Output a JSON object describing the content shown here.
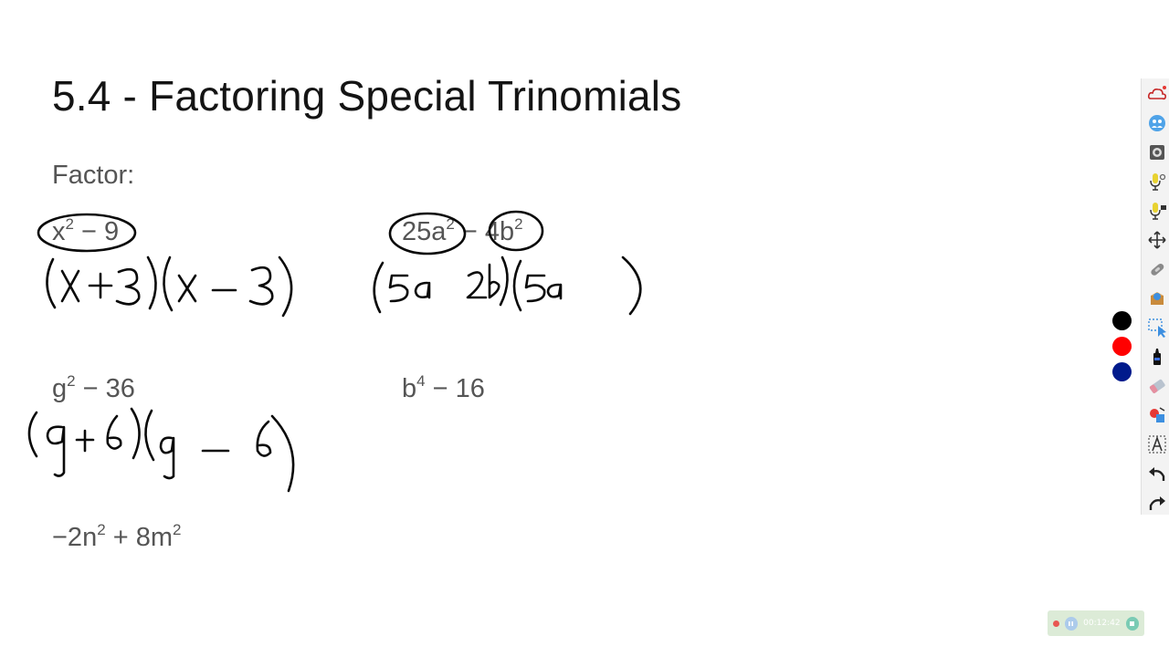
{
  "slide": {
    "title": "5.4 - Factoring Special Trinomials",
    "prompt": "Factor:"
  },
  "problems": [
    {
      "pre": "x",
      "sup1": "2",
      "mid": " − 9",
      "sup2": "",
      "post": ""
    },
    {
      "pre": "25a",
      "sup1": "2",
      "mid": " − 4b",
      "sup2": "2",
      "post": ""
    },
    {
      "pre": "g",
      "sup1": "2",
      "mid": " − 36",
      "sup2": "",
      "post": ""
    },
    {
      "pre": "b",
      "sup1": "4",
      "mid": " − 16",
      "sup2": "",
      "post": ""
    },
    {
      "pre": "−2n",
      "sup1": "2",
      "mid": " + 8m",
      "sup2": "2",
      "post": ""
    }
  ],
  "pen_colors": [
    "#000000",
    "#ff0000",
    "#001a8c"
  ],
  "toolbar": {
    "tools": [
      "myscreen-cloud-icon",
      "community-icon",
      "screenshot-icon",
      "mic-settings-icon",
      "mic-folder-icon",
      "move-icon",
      "link-icon",
      "shapes-icon",
      "select-icon",
      "marker-icon",
      "eraser-icon",
      "shape-fill-icon",
      "text-icon",
      "undo-icon",
      "redo-icon"
    ]
  },
  "recorder": {
    "time": "00:12:42"
  }
}
